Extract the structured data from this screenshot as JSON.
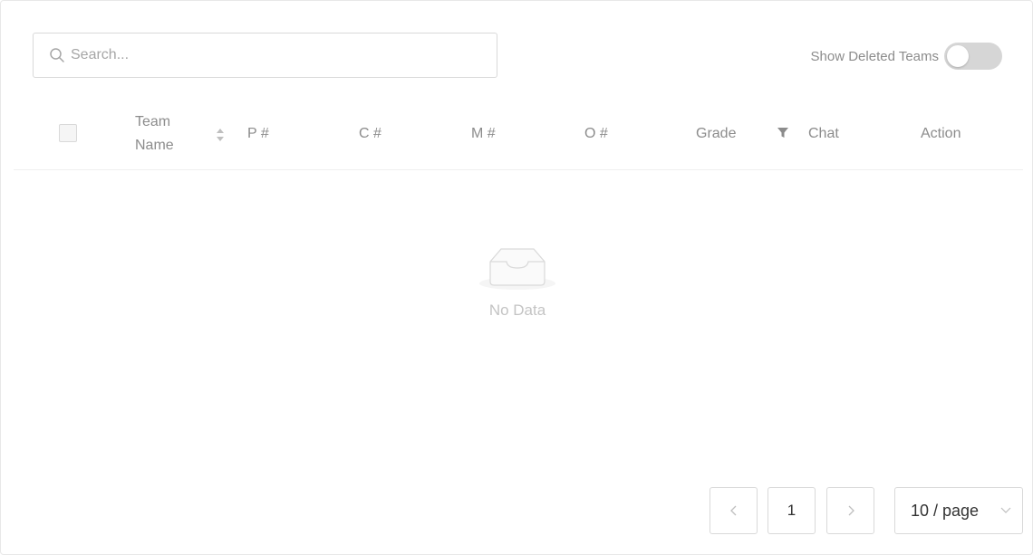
{
  "search": {
    "placeholder": "Search..."
  },
  "toggle": {
    "label": "Show Deleted Teams",
    "on": false
  },
  "table": {
    "columns": [
      "Team Name",
      "P #",
      "C #",
      "M #",
      "O #",
      "Grade",
      "Chat",
      "Action"
    ],
    "empty_text": "No Data"
  },
  "pagination": {
    "current_page": "1",
    "page_size_label": "10 / page"
  },
  "colors": {
    "muted_text": "#8c8c8c",
    "border": "#d9d9d9",
    "toggle_off": "#d6d6d6"
  }
}
